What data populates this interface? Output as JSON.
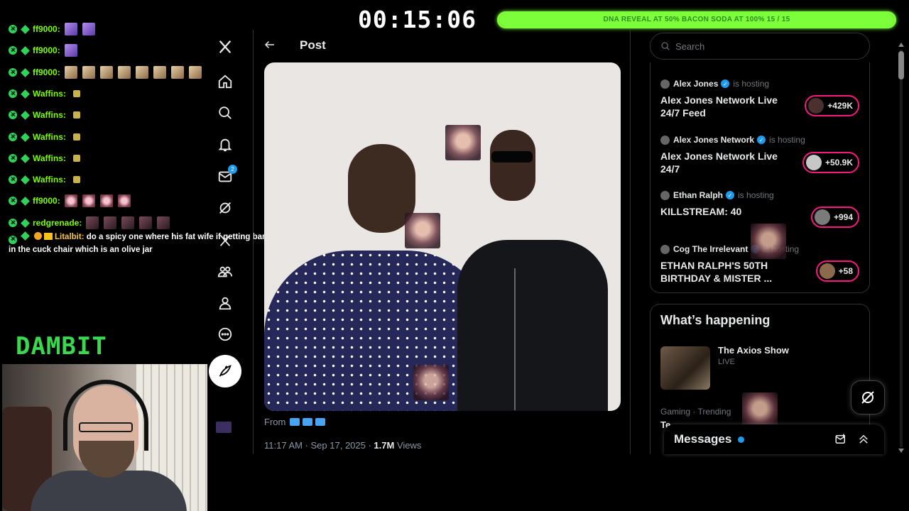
{
  "timer": "00:15:06",
  "progress": {
    "label": "DNA REVEAL AT 50% BACON SODA AT 100% 15 / 15",
    "fraction": 1.0,
    "color": "#7cff3a"
  },
  "chat": {
    "lines": [
      {
        "user": "ff9000:",
        "emotes": [
          "purple",
          "purple"
        ]
      },
      {
        "user": "ff9000:",
        "emotes": [
          "purple"
        ]
      },
      {
        "user": "ff9000:",
        "emotes": [
          "tan",
          "tan",
          "tan",
          "tan",
          "tan",
          "tan",
          "tan",
          "tan"
        ]
      },
      {
        "user": "Waffins:",
        "emotes": [
          "small"
        ]
      },
      {
        "user": "Waffins:",
        "emotes": [
          "small"
        ]
      },
      {
        "user": "Waffins:",
        "emotes": [
          "small"
        ]
      },
      {
        "user": "Waffins:",
        "emotes": [
          "small"
        ]
      },
      {
        "user": "Waffins:",
        "emotes": [
          "small"
        ]
      },
      {
        "user": "ff9000:",
        "emotes": [
          "pink",
          "pink",
          "pink",
          "pink"
        ]
      },
      {
        "user": "redgrenade:",
        "emotes": [
          "dark",
          "dark",
          "dark",
          "dark",
          "dark"
        ]
      }
    ],
    "last_message": {
      "user": "Litalbit:",
      "text": "do a spicy one where his fat wife if getting banged and he's in the cuck chair which is an olive jar"
    }
  },
  "brand": "DAMBIT",
  "nav": {
    "items": [
      {
        "icon": "x-logo-icon"
      },
      {
        "icon": "home-icon"
      },
      {
        "icon": "explore-icon"
      },
      {
        "icon": "notifications-icon"
      },
      {
        "icon": "messages-icon"
      },
      {
        "icon": "grok-icon"
      },
      {
        "icon": "premium-icon"
      },
      {
        "icon": "communities-icon"
      },
      {
        "icon": "profile-icon"
      },
      {
        "icon": "more-icon"
      }
    ],
    "messages_badge": "2",
    "post_button_icon": "compose-icon"
  },
  "post": {
    "header_title": "Post",
    "from_label": "From",
    "timestamp": "11:17 AM · Sep 17, 2025 · ",
    "views_count": "1.7M",
    "views_label": " Views"
  },
  "search": {
    "placeholder": "Search"
  },
  "live": [
    {
      "host": "Alex Jones",
      "status": "is hosting",
      "title": "Alex Jones Network Live 24/7 Feed",
      "listeners": "+429K"
    },
    {
      "host": "Alex Jones Network",
      "status": "is hosting",
      "title": "Alex Jones Network Live 24/7",
      "listeners": "+50.9K"
    },
    {
      "host": "Ethan Ralph",
      "status": "is hosting",
      "title": "KILLSTREAM: 40",
      "listeners": "+994"
    },
    {
      "host": "Cog The Irrelevant",
      "status": "is hosting",
      "title": "ETHAN RALPH'S 50TH BIRTHDAY & MISTER ...",
      "listeners": "+58"
    }
  ],
  "happening": {
    "title": "What’s happening",
    "axios": {
      "name": "The Axios Show",
      "status": "LIVE"
    },
    "trend": {
      "category": "Gaming · Trending",
      "name": "Te"
    }
  },
  "messages": {
    "label": "Messages"
  },
  "colors": {
    "accent_blue": "#1d9bf0",
    "live_pink": "#f91880",
    "chat_green": "#7cfc00"
  }
}
